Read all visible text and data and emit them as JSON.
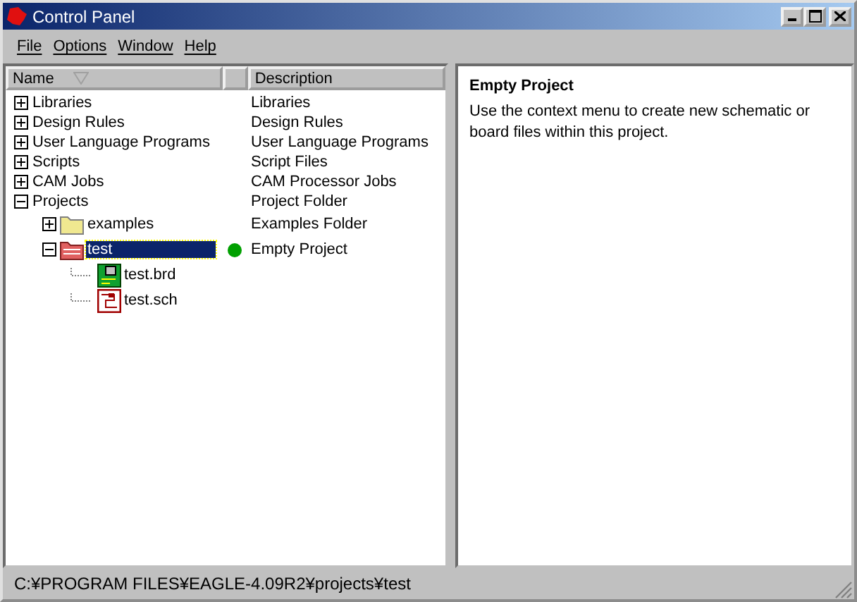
{
  "window": {
    "title": "Control Panel"
  },
  "menu": [
    "File",
    "Options",
    "Window",
    "Help"
  ],
  "columns": [
    "Name",
    "Description"
  ],
  "tree": [
    {
      "name": "Libraries",
      "description": "Libraries",
      "expanded": false,
      "selected": false
    },
    {
      "name": "Design Rules",
      "description": "Design Rules",
      "expanded": false,
      "selected": false
    },
    {
      "name": "User Language Programs",
      "description": "User Language Programs",
      "expanded": false,
      "selected": false
    },
    {
      "name": "Scripts",
      "description": "Script Files",
      "expanded": false,
      "selected": false
    },
    {
      "name": "CAM Jobs",
      "description": "CAM Processor Jobs",
      "expanded": false,
      "selected": false
    },
    {
      "name": "Projects",
      "description": "Project Folder",
      "expanded": true,
      "selected": false,
      "children": [
        {
          "name": "examples",
          "description": "Examples Folder",
          "kind": "folder",
          "expanded": false,
          "selected": false
        },
        {
          "name": "test",
          "description": "Empty Project",
          "kind": "project",
          "expanded": true,
          "selected": true,
          "color": "#00a000",
          "children": [
            {
              "name": "test.brd",
              "kind": "board",
              "selected": false
            },
            {
              "name": "test.sch",
              "kind": "schematic",
              "selected": false
            }
          ]
        }
      ]
    }
  ],
  "detail": {
    "title": "Empty Project",
    "text": "Use the context menu to create new schematic or board files within this project."
  },
  "status_bar": "C:¥PROGRAM FILES¥EAGLE-4.09R2¥projects¥test"
}
